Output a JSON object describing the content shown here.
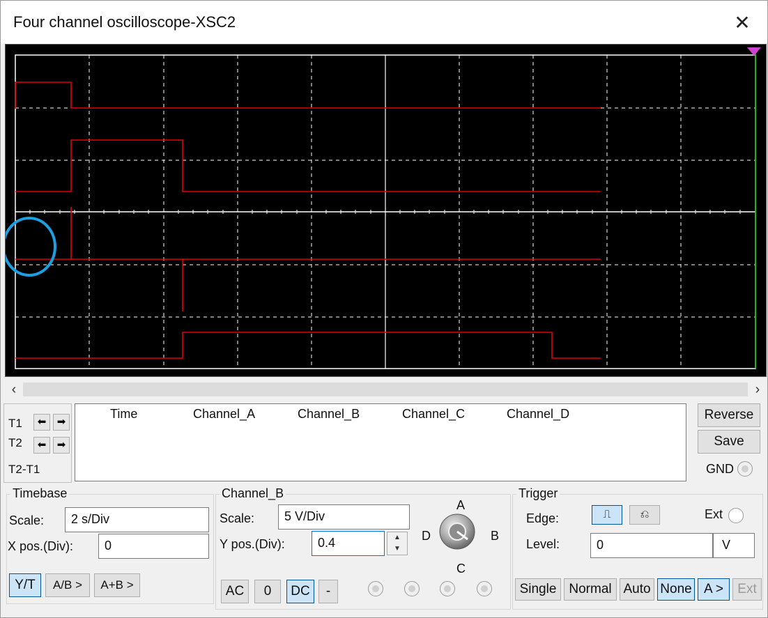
{
  "window": {
    "title": "Four channel oscilloscope-XSC2",
    "close_icon": "close-icon"
  },
  "cursor_panel": {
    "t1": "T1",
    "t2": "T2",
    "t2_t1": "T2-T1"
  },
  "readout": {
    "columns": [
      "Time",
      "Channel_A",
      "Channel_B",
      "Channel_C",
      "Channel_D"
    ]
  },
  "side_buttons": {
    "reverse": "Reverse",
    "save": "Save",
    "gnd": "GND"
  },
  "timebase": {
    "title": "Timebase",
    "scale_label": "Scale:",
    "scale_value": "2  s/Div",
    "xpos_label": "X pos.(Div):",
    "xpos_value": "0",
    "modes": [
      "Y/T",
      "A/B >",
      "A+B >"
    ],
    "active_mode": "Y/T"
  },
  "channel": {
    "title": "Channel_B",
    "scale_label": "Scale:",
    "scale_value": "5  V/Div",
    "ypos_label": "Y pos.(Div):",
    "ypos_value": "0.4",
    "coupling": [
      "AC",
      "0",
      "DC",
      "-"
    ],
    "active_coupling": "DC",
    "knob_labels": {
      "a": "A",
      "b": "B",
      "c": "C",
      "d": "D"
    }
  },
  "trigger": {
    "title": "Trigger",
    "edge_label": "Edge:",
    "ext_label": "Ext",
    "level_label": "Level:",
    "level_value": "0",
    "level_unit": "V",
    "modes": [
      "Single",
      "Normal",
      "Auto",
      "None",
      "A >",
      "Ext"
    ],
    "active_mode": "None"
  },
  "colors": {
    "trace": "#e00000",
    "grid": "#ffffff",
    "screen": "#000000",
    "cursor": "#00c000",
    "highlight": "#1ba1e2"
  }
}
